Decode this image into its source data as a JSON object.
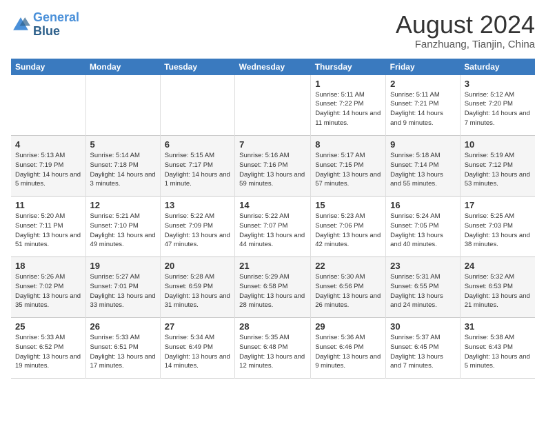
{
  "logo": {
    "line1": "General",
    "line2": "Blue"
  },
  "title": "August 2024",
  "subtitle": "Fanzhuang, Tianjin, China",
  "weekdays": [
    "Sunday",
    "Monday",
    "Tuesday",
    "Wednesday",
    "Thursday",
    "Friday",
    "Saturday"
  ],
  "weeks": [
    [
      {
        "day": "",
        "sunrise": "",
        "sunset": "",
        "daylight": ""
      },
      {
        "day": "",
        "sunrise": "",
        "sunset": "",
        "daylight": ""
      },
      {
        "day": "",
        "sunrise": "",
        "sunset": "",
        "daylight": ""
      },
      {
        "day": "",
        "sunrise": "",
        "sunset": "",
        "daylight": ""
      },
      {
        "day": "1",
        "sunrise": "Sunrise: 5:11 AM",
        "sunset": "Sunset: 7:22 PM",
        "daylight": "Daylight: 14 hours and 11 minutes."
      },
      {
        "day": "2",
        "sunrise": "Sunrise: 5:11 AM",
        "sunset": "Sunset: 7:21 PM",
        "daylight": "Daylight: 14 hours and 9 minutes."
      },
      {
        "day": "3",
        "sunrise": "Sunrise: 5:12 AM",
        "sunset": "Sunset: 7:20 PM",
        "daylight": "Daylight: 14 hours and 7 minutes."
      }
    ],
    [
      {
        "day": "4",
        "sunrise": "Sunrise: 5:13 AM",
        "sunset": "Sunset: 7:19 PM",
        "daylight": "Daylight: 14 hours and 5 minutes."
      },
      {
        "day": "5",
        "sunrise": "Sunrise: 5:14 AM",
        "sunset": "Sunset: 7:18 PM",
        "daylight": "Daylight: 14 hours and 3 minutes."
      },
      {
        "day": "6",
        "sunrise": "Sunrise: 5:15 AM",
        "sunset": "Sunset: 7:17 PM",
        "daylight": "Daylight: 14 hours and 1 minute."
      },
      {
        "day": "7",
        "sunrise": "Sunrise: 5:16 AM",
        "sunset": "Sunset: 7:16 PM",
        "daylight": "Daylight: 13 hours and 59 minutes."
      },
      {
        "day": "8",
        "sunrise": "Sunrise: 5:17 AM",
        "sunset": "Sunset: 7:15 PM",
        "daylight": "Daylight: 13 hours and 57 minutes."
      },
      {
        "day": "9",
        "sunrise": "Sunrise: 5:18 AM",
        "sunset": "Sunset: 7:14 PM",
        "daylight": "Daylight: 13 hours and 55 minutes."
      },
      {
        "day": "10",
        "sunrise": "Sunrise: 5:19 AM",
        "sunset": "Sunset: 7:12 PM",
        "daylight": "Daylight: 13 hours and 53 minutes."
      }
    ],
    [
      {
        "day": "11",
        "sunrise": "Sunrise: 5:20 AM",
        "sunset": "Sunset: 7:11 PM",
        "daylight": "Daylight: 13 hours and 51 minutes."
      },
      {
        "day": "12",
        "sunrise": "Sunrise: 5:21 AM",
        "sunset": "Sunset: 7:10 PM",
        "daylight": "Daylight: 13 hours and 49 minutes."
      },
      {
        "day": "13",
        "sunrise": "Sunrise: 5:22 AM",
        "sunset": "Sunset: 7:09 PM",
        "daylight": "Daylight: 13 hours and 47 minutes."
      },
      {
        "day": "14",
        "sunrise": "Sunrise: 5:22 AM",
        "sunset": "Sunset: 7:07 PM",
        "daylight": "Daylight: 13 hours and 44 minutes."
      },
      {
        "day": "15",
        "sunrise": "Sunrise: 5:23 AM",
        "sunset": "Sunset: 7:06 PM",
        "daylight": "Daylight: 13 hours and 42 minutes."
      },
      {
        "day": "16",
        "sunrise": "Sunrise: 5:24 AM",
        "sunset": "Sunset: 7:05 PM",
        "daylight": "Daylight: 13 hours and 40 minutes."
      },
      {
        "day": "17",
        "sunrise": "Sunrise: 5:25 AM",
        "sunset": "Sunset: 7:03 PM",
        "daylight": "Daylight: 13 hours and 38 minutes."
      }
    ],
    [
      {
        "day": "18",
        "sunrise": "Sunrise: 5:26 AM",
        "sunset": "Sunset: 7:02 PM",
        "daylight": "Daylight: 13 hours and 35 minutes."
      },
      {
        "day": "19",
        "sunrise": "Sunrise: 5:27 AM",
        "sunset": "Sunset: 7:01 PM",
        "daylight": "Daylight: 13 hours and 33 minutes."
      },
      {
        "day": "20",
        "sunrise": "Sunrise: 5:28 AM",
        "sunset": "Sunset: 6:59 PM",
        "daylight": "Daylight: 13 hours and 31 minutes."
      },
      {
        "day": "21",
        "sunrise": "Sunrise: 5:29 AM",
        "sunset": "Sunset: 6:58 PM",
        "daylight": "Daylight: 13 hours and 28 minutes."
      },
      {
        "day": "22",
        "sunrise": "Sunrise: 5:30 AM",
        "sunset": "Sunset: 6:56 PM",
        "daylight": "Daylight: 13 hours and 26 minutes."
      },
      {
        "day": "23",
        "sunrise": "Sunrise: 5:31 AM",
        "sunset": "Sunset: 6:55 PM",
        "daylight": "Daylight: 13 hours and 24 minutes."
      },
      {
        "day": "24",
        "sunrise": "Sunrise: 5:32 AM",
        "sunset": "Sunset: 6:53 PM",
        "daylight": "Daylight: 13 hours and 21 minutes."
      }
    ],
    [
      {
        "day": "25",
        "sunrise": "Sunrise: 5:33 AM",
        "sunset": "Sunset: 6:52 PM",
        "daylight": "Daylight: 13 hours and 19 minutes."
      },
      {
        "day": "26",
        "sunrise": "Sunrise: 5:33 AM",
        "sunset": "Sunset: 6:51 PM",
        "daylight": "Daylight: 13 hours and 17 minutes."
      },
      {
        "day": "27",
        "sunrise": "Sunrise: 5:34 AM",
        "sunset": "Sunset: 6:49 PM",
        "daylight": "Daylight: 13 hours and 14 minutes."
      },
      {
        "day": "28",
        "sunrise": "Sunrise: 5:35 AM",
        "sunset": "Sunset: 6:48 PM",
        "daylight": "Daylight: 13 hours and 12 minutes."
      },
      {
        "day": "29",
        "sunrise": "Sunrise: 5:36 AM",
        "sunset": "Sunset: 6:46 PM",
        "daylight": "Daylight: 13 hours and 9 minutes."
      },
      {
        "day": "30",
        "sunrise": "Sunrise: 5:37 AM",
        "sunset": "Sunset: 6:45 PM",
        "daylight": "Daylight: 13 hours and 7 minutes."
      },
      {
        "day": "31",
        "sunrise": "Sunrise: 5:38 AM",
        "sunset": "Sunset: 6:43 PM",
        "daylight": "Daylight: 13 hours and 5 minutes."
      }
    ]
  ]
}
